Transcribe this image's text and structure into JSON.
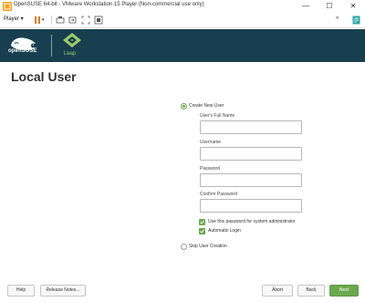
{
  "window": {
    "title": "OpenSUSE 64-bit - VMware Workstation 15 Player (Non-commercial use only)",
    "controls": {
      "minimize": "—",
      "maximize": "☐",
      "close": "✕"
    }
  },
  "vm_toolbar": {
    "player_menu": "Player ▾",
    "collapse_label": "«"
  },
  "header": {
    "brand": "openSUSE",
    "product": "Leap"
  },
  "page": {
    "title": "Local User",
    "create_user_option": "Create New User",
    "full_name_label": "User's Full Name",
    "username_label": "Username",
    "password_label": "Password",
    "confirm_password_label": "Confirm Password",
    "full_name_value": "",
    "username_value": "",
    "password_value": "",
    "confirm_password_value": "",
    "admin_checkbox_label": "Use this password for system administrator",
    "autologin_checkbox_label": "Automatic Login",
    "skip_option": "Skip User Creation"
  },
  "buttons": {
    "help": "Help",
    "release_notes": "Release Notes...",
    "abort": "Abort",
    "back": "Back",
    "next": "Next"
  },
  "colors": {
    "header_bg": "#173f4f",
    "accent_green": "#6aa84f",
    "leap_green": "#9ccc65"
  }
}
